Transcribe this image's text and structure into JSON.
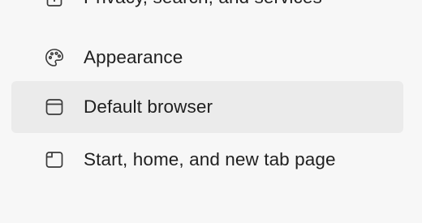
{
  "sidebar": {
    "items": [
      {
        "label": "Privacy, search, and services",
        "icon": "lock-icon",
        "selected": false
      },
      {
        "label": "Appearance",
        "icon": "palette-icon",
        "selected": false
      },
      {
        "label": "Default browser",
        "icon": "browser-window-icon",
        "selected": true
      },
      {
        "label": "Start, home, and new tab page",
        "icon": "home-page-icon",
        "selected": false
      }
    ]
  },
  "colors": {
    "background": "#f7f7f7",
    "selected_background": "#ebebeb",
    "text": "#1f1f1f",
    "icon_stroke": "#3a3a3a"
  }
}
